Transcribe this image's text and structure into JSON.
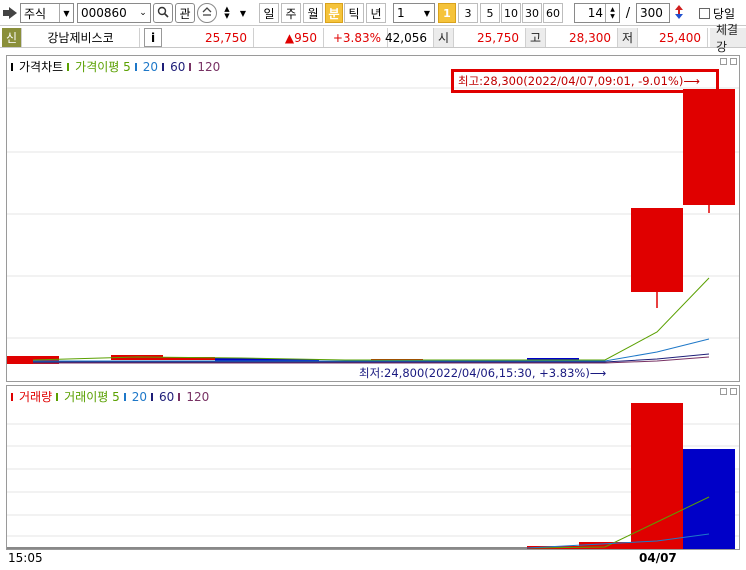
{
  "toolbar": {
    "market": "주식",
    "code": "000860",
    "btn_gwan": "관",
    "periods": [
      "일",
      "주",
      "월",
      "분",
      "틱",
      "년"
    ],
    "active_period": "분",
    "interval_value": "1",
    "intervals": [
      "1",
      "3",
      "5",
      "10",
      "30",
      "60"
    ],
    "active_interval": "1",
    "count_value": "14",
    "separator": "/",
    "total_value": "300",
    "today_label": "당일"
  },
  "infobar": {
    "badge": "신",
    "name": "강남제비스코",
    "info_btn": "i",
    "price": "25,750",
    "change": "▲950",
    "change_rate": "+3.83%",
    "volume": "42,056",
    "open_label": "시",
    "open": "25,750",
    "high_label": "고",
    "high": "28,300",
    "low_label": "저",
    "low": "25,400",
    "trade_label": "체결강"
  },
  "price_pane": {
    "legend_title": "가격차트",
    "legend_ma_title": "가격이평 5",
    "legend_ma": [
      "20",
      "60",
      "120"
    ],
    "high_callout": "최고:28,300(2022/04/07,09:01, -9.01%)⟶",
    "low_callout": "최저:24,800(2022/04/06,15:30, +3.83%)⟶"
  },
  "volume_pane": {
    "legend_title": "거래량",
    "legend_ma_title": "거래이평 5",
    "legend_ma": [
      "20",
      "60",
      "120"
    ]
  },
  "xaxis": {
    "left_label": "15:05",
    "date_label": "04/07"
  },
  "colors": {
    "up": "#e00000",
    "down": "#0000c8",
    "ma5": "#5aa000",
    "ma20": "#1e78c8",
    "ma60": "#1e1e78",
    "ma120": "#783264"
  }
}
